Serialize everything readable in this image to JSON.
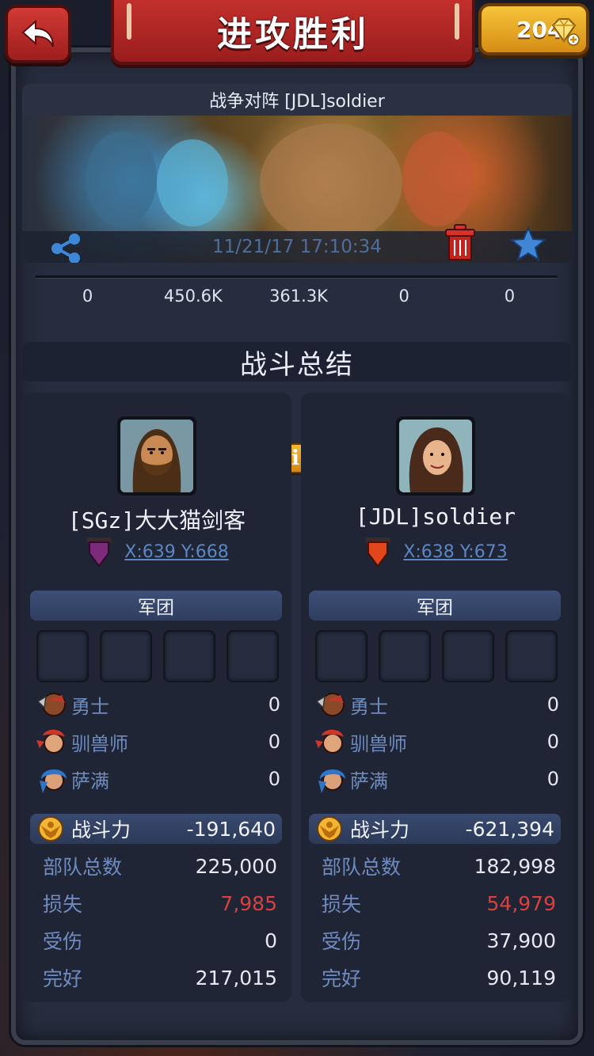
{
  "header": {
    "title": "进攻胜利",
    "gems": "204"
  },
  "battle": {
    "title": "战争对阵 [JDL]soldier",
    "timestamp": "11/21/17 17:10:34",
    "stats": [
      "0",
      "450.6K",
      "361.3K",
      "0",
      "0"
    ]
  },
  "section_title": "战斗总结",
  "attacker": {
    "name": "[SGz]大大猫剑客",
    "coords": "X:639 Y:668",
    "flag_color": "#7b2b7a",
    "legion_label": "军团",
    "troops": [
      {
        "name": "勇士",
        "count": "0",
        "icon": "warrior-icon"
      },
      {
        "name": "驯兽师",
        "count": "0",
        "icon": "beast-tamer-icon"
      },
      {
        "name": "萨满",
        "count": "0",
        "icon": "shaman-icon"
      }
    ],
    "power_label": "战斗力",
    "power_value": "-191,640",
    "summary": [
      {
        "label": "部队总数",
        "value": "225,000"
      },
      {
        "label": "损失",
        "value": "7,985"
      },
      {
        "label": "受伤",
        "value": "0"
      },
      {
        "label": "完好",
        "value": "217,015"
      }
    ]
  },
  "defender": {
    "name": "[JDL]soldier",
    "coords": "X:638 Y:673",
    "flag_color": "#e2461c",
    "legion_label": "军团",
    "troops": [
      {
        "name": "勇士",
        "count": "0",
        "icon": "warrior-icon"
      },
      {
        "name": "驯兽师",
        "count": "0",
        "icon": "beast-tamer-icon"
      },
      {
        "name": "萨满",
        "count": "0",
        "icon": "shaman-icon"
      }
    ],
    "power_label": "战斗力",
    "power_value": "-621,394",
    "summary": [
      {
        "label": "部队总数",
        "value": "182,998"
      },
      {
        "label": "损失",
        "value": "54,979"
      },
      {
        "label": "受伤",
        "value": "37,900"
      },
      {
        "label": "完好",
        "value": "90,119"
      }
    ]
  },
  "info_button": "i",
  "colors": {
    "loss": "#d8413d",
    "link": "#5d86c2",
    "label_blue": "#6f8bc0",
    "banner_red": "#b72a27",
    "gold": "#f2b637"
  }
}
